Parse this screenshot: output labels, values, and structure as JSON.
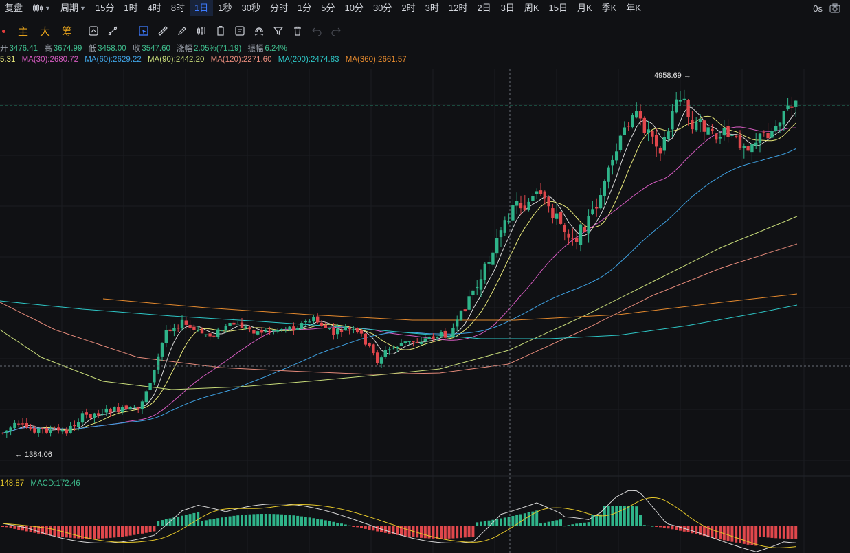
{
  "topbar": {
    "view_label": "复盘",
    "period_label": "周期",
    "periods": [
      "15分",
      "1时",
      "4时",
      "8时",
      "1日",
      "1秒",
      "30秒",
      "分时",
      "1分",
      "5分",
      "10分",
      "30分",
      "2时",
      "3时",
      "12时",
      "2日",
      "3日",
      "周K",
      "15日",
      "月K",
      "季K",
      "年K"
    ],
    "active_period": "1日",
    "timer": "0s"
  },
  "toolbar": {
    "indicators": [
      "主",
      "大",
      "筹"
    ],
    "tools": [
      "select-icon",
      "ruler-icon",
      "pen-icon",
      "candle-type-icon",
      "layer-icon",
      "note-icon",
      "magnet-icon",
      "filter-icon",
      "delete-icon",
      "undo-icon",
      "redo-icon"
    ]
  },
  "ohlc": {
    "open_label": "开",
    "open": "3476.41",
    "high_label": "高",
    "high": "3674.99",
    "low_label": "低",
    "low": "3458.00",
    "close_label": "收",
    "close": "3547.60",
    "change_label": "涨幅",
    "change": "2.05%(71.19)",
    "amp_label": "振幅",
    "amp": "6.24%"
  },
  "ma": {
    "first_partial": "5.31",
    "ma30": "MA(30):2680.72",
    "ma60": "MA(60):2629.22",
    "ma90": "MA(90):2442.20",
    "ma120": "MA(120):2271.60",
    "ma200": "MA(200):2474.83",
    "ma360": "MA(360):2661.57"
  },
  "colors": {
    "up": "#2fb48a",
    "down": "#e0474c",
    "ma_first": "#e8e87a",
    "ma30": "#d55bc0",
    "ma60": "#3fa2e3",
    "ma90": "#c8dc7a",
    "ma120": "#e58a7a",
    "ma200": "#2ec7c7",
    "ma360": "#e58a2e",
    "macd_dif": "#d8d8d8",
    "macd_dea": "#e5c72a"
  },
  "annotations": {
    "max_label": "4958.69",
    "min_label": "1384.06"
  },
  "macd": {
    "partial_value": "148.87",
    "label": "MACD:172.46"
  },
  "chart_data": {
    "type": "candlestick",
    "series": "daily candles",
    "price_range": [
      1250,
      5150
    ],
    "highest": 4958.69,
    "lowest": 1384.06,
    "last_close": 3547.6
  }
}
